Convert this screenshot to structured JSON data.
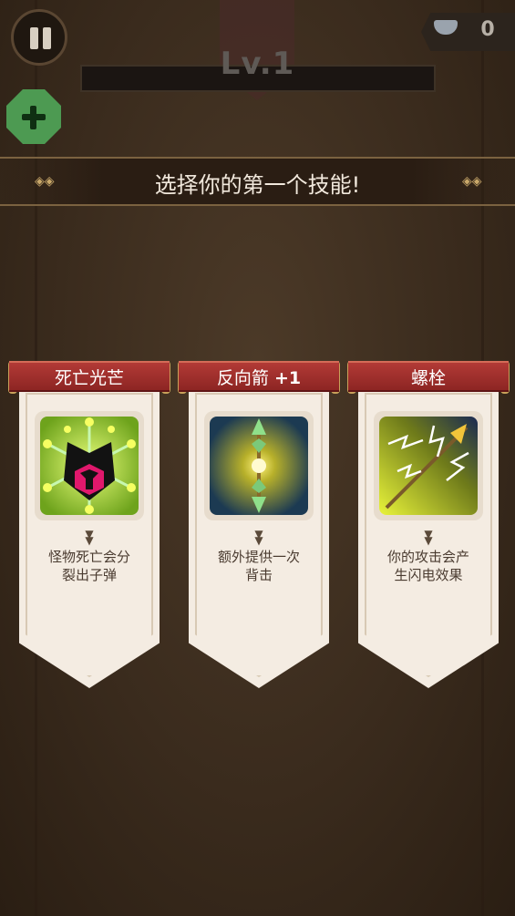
{
  "hud": {
    "level": "Lv.1",
    "currency_value": "0"
  },
  "title": "选择你的第一个技能!",
  "skills": [
    {
      "name": "死亡光芒",
      "bonus": "",
      "description_line1": "怪物死亡会分",
      "description_line2": "裂出子弹",
      "icon": "death-ray-icon"
    },
    {
      "name": "反向箭",
      "bonus": "+1",
      "description_line1": "额外提供一次",
      "description_line2": "背击",
      "icon": "rear-arrow-icon"
    },
    {
      "name": "螺栓",
      "bonus": "",
      "description_line1": "你的攻击会产",
      "description_line2": "生闪电效果",
      "icon": "lightning-bolt-icon"
    }
  ],
  "colors": {
    "ribbon": "#a32f2c",
    "card": "#f4ece2",
    "add_button": "#4d9a52"
  }
}
